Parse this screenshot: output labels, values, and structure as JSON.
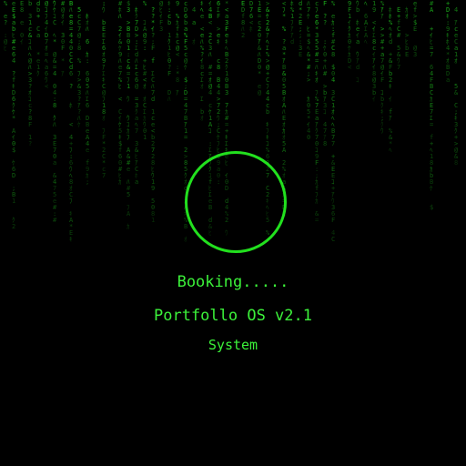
{
  "boot": {
    "status": "Booking.....",
    "title": "Portfollo OS v2.1",
    "subtitle": "System"
  },
  "colors": {
    "background": "#000000",
    "accent": "#22e01e",
    "text": "#3cf23a",
    "rain": "#1fbf1f"
  },
  "icons": {
    "loader": "loading-ring-icon",
    "background": "matrix-code-rain"
  }
}
